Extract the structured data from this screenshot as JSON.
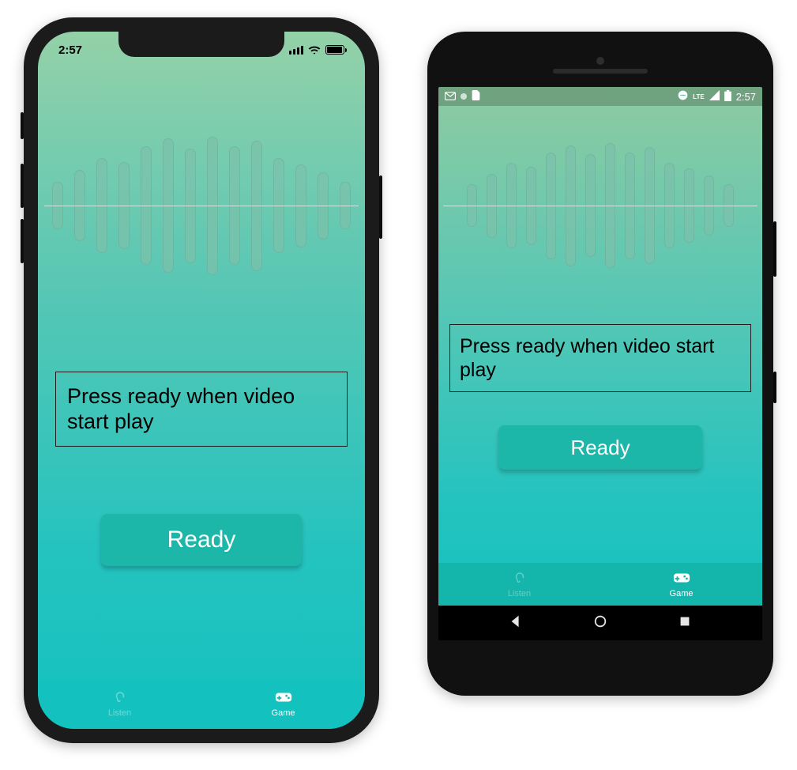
{
  "ios": {
    "status": {
      "time": "2:57"
    },
    "message": "Press ready when video start play",
    "ready_label": "Ready",
    "tabs": [
      {
        "icon": "ear-icon",
        "label": "Listen"
      },
      {
        "icon": "gamepad-icon",
        "label": "Game"
      }
    ],
    "active_tab": 1
  },
  "android": {
    "status": {
      "time": "2:57",
      "net": "LTE"
    },
    "message": "Press ready when video start play",
    "ready_label": "Ready",
    "tabs": [
      {
        "icon": "ear-icon",
        "label": "Listen"
      },
      {
        "icon": "gamepad-icon",
        "label": "Game"
      }
    ],
    "active_tab": 1
  },
  "waveform_bar_heights": [
    60,
    90,
    120,
    110,
    150,
    170,
    145,
    175,
    150,
    165,
    120,
    105,
    85,
    60
  ],
  "colors": {
    "grad_top": "#94d1a8",
    "grad_bottom": "#14c2bf",
    "button": "#1cb7a9"
  }
}
